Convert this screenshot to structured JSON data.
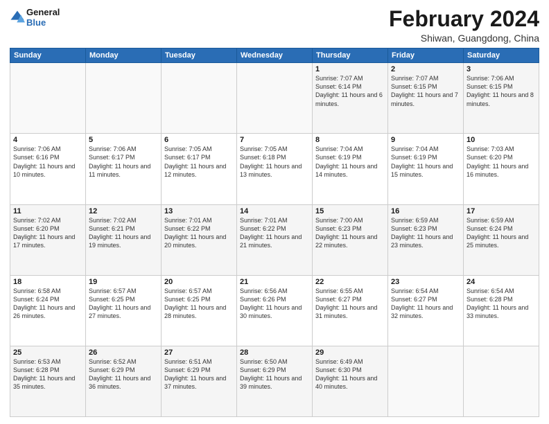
{
  "logo": {
    "line1": "General",
    "line2": "Blue"
  },
  "title": "February 2024",
  "location": "Shiwan, Guangdong, China",
  "headers": [
    "Sunday",
    "Monday",
    "Tuesday",
    "Wednesday",
    "Thursday",
    "Friday",
    "Saturday"
  ],
  "weeks": [
    [
      {
        "day": "",
        "info": ""
      },
      {
        "day": "",
        "info": ""
      },
      {
        "day": "",
        "info": ""
      },
      {
        "day": "",
        "info": ""
      },
      {
        "day": "1",
        "info": "Sunrise: 7:07 AM\nSunset: 6:14 PM\nDaylight: 11 hours\nand 6 minutes."
      },
      {
        "day": "2",
        "info": "Sunrise: 7:07 AM\nSunset: 6:15 PM\nDaylight: 11 hours\nand 7 minutes."
      },
      {
        "day": "3",
        "info": "Sunrise: 7:06 AM\nSunset: 6:15 PM\nDaylight: 11 hours\nand 8 minutes."
      }
    ],
    [
      {
        "day": "4",
        "info": "Sunrise: 7:06 AM\nSunset: 6:16 PM\nDaylight: 11 hours\nand 10 minutes."
      },
      {
        "day": "5",
        "info": "Sunrise: 7:06 AM\nSunset: 6:17 PM\nDaylight: 11 hours\nand 11 minutes."
      },
      {
        "day": "6",
        "info": "Sunrise: 7:05 AM\nSunset: 6:17 PM\nDaylight: 11 hours\nand 12 minutes."
      },
      {
        "day": "7",
        "info": "Sunrise: 7:05 AM\nSunset: 6:18 PM\nDaylight: 11 hours\nand 13 minutes."
      },
      {
        "day": "8",
        "info": "Sunrise: 7:04 AM\nSunset: 6:19 PM\nDaylight: 11 hours\nand 14 minutes."
      },
      {
        "day": "9",
        "info": "Sunrise: 7:04 AM\nSunset: 6:19 PM\nDaylight: 11 hours\nand 15 minutes."
      },
      {
        "day": "10",
        "info": "Sunrise: 7:03 AM\nSunset: 6:20 PM\nDaylight: 11 hours\nand 16 minutes."
      }
    ],
    [
      {
        "day": "11",
        "info": "Sunrise: 7:02 AM\nSunset: 6:20 PM\nDaylight: 11 hours\nand 17 minutes."
      },
      {
        "day": "12",
        "info": "Sunrise: 7:02 AM\nSunset: 6:21 PM\nDaylight: 11 hours\nand 19 minutes."
      },
      {
        "day": "13",
        "info": "Sunrise: 7:01 AM\nSunset: 6:22 PM\nDaylight: 11 hours\nand 20 minutes."
      },
      {
        "day": "14",
        "info": "Sunrise: 7:01 AM\nSunset: 6:22 PM\nDaylight: 11 hours\nand 21 minutes."
      },
      {
        "day": "15",
        "info": "Sunrise: 7:00 AM\nSunset: 6:23 PM\nDaylight: 11 hours\nand 22 minutes."
      },
      {
        "day": "16",
        "info": "Sunrise: 6:59 AM\nSunset: 6:23 PM\nDaylight: 11 hours\nand 23 minutes."
      },
      {
        "day": "17",
        "info": "Sunrise: 6:59 AM\nSunset: 6:24 PM\nDaylight: 11 hours\nand 25 minutes."
      }
    ],
    [
      {
        "day": "18",
        "info": "Sunrise: 6:58 AM\nSunset: 6:24 PM\nDaylight: 11 hours\nand 26 minutes."
      },
      {
        "day": "19",
        "info": "Sunrise: 6:57 AM\nSunset: 6:25 PM\nDaylight: 11 hours\nand 27 minutes."
      },
      {
        "day": "20",
        "info": "Sunrise: 6:57 AM\nSunset: 6:25 PM\nDaylight: 11 hours\nand 28 minutes."
      },
      {
        "day": "21",
        "info": "Sunrise: 6:56 AM\nSunset: 6:26 PM\nDaylight: 11 hours\nand 30 minutes."
      },
      {
        "day": "22",
        "info": "Sunrise: 6:55 AM\nSunset: 6:27 PM\nDaylight: 11 hours\nand 31 minutes."
      },
      {
        "day": "23",
        "info": "Sunrise: 6:54 AM\nSunset: 6:27 PM\nDaylight: 11 hours\nand 32 minutes."
      },
      {
        "day": "24",
        "info": "Sunrise: 6:54 AM\nSunset: 6:28 PM\nDaylight: 11 hours\nand 33 minutes."
      }
    ],
    [
      {
        "day": "25",
        "info": "Sunrise: 6:53 AM\nSunset: 6:28 PM\nDaylight: 11 hours\nand 35 minutes."
      },
      {
        "day": "26",
        "info": "Sunrise: 6:52 AM\nSunset: 6:29 PM\nDaylight: 11 hours\nand 36 minutes."
      },
      {
        "day": "27",
        "info": "Sunrise: 6:51 AM\nSunset: 6:29 PM\nDaylight: 11 hours\nand 37 minutes."
      },
      {
        "day": "28",
        "info": "Sunrise: 6:50 AM\nSunset: 6:29 PM\nDaylight: 11 hours\nand 39 minutes."
      },
      {
        "day": "29",
        "info": "Sunrise: 6:49 AM\nSunset: 6:30 PM\nDaylight: 11 hours\nand 40 minutes."
      },
      {
        "day": "",
        "info": ""
      },
      {
        "day": "",
        "info": ""
      }
    ]
  ]
}
